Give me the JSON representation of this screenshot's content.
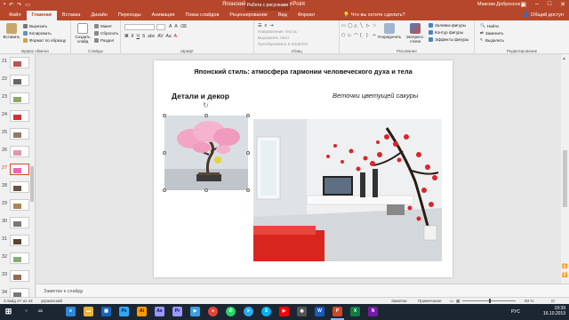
{
  "window": {
    "title": "Японский стиль.pptx - PowerPoint",
    "context_tab": "Работа с рисунками",
    "user": "Максим Доброскок"
  },
  "tabs": [
    "Файл",
    "Главная",
    "Вставка",
    "Дизайн",
    "Переходы",
    "Анимация",
    "Показ слайдов",
    "Рецензирование",
    "Вид",
    "Формат"
  ],
  "tell_me": "Что вы хотите сделать?",
  "share": "Общий доступ",
  "ribbon": {
    "paste": "Вставить",
    "cut": "Вырезать",
    "copy": "Копировать",
    "format_painter": "Формат по образцу",
    "clipboard_label": "Буфер обмена",
    "new_slide": "Создать слайд",
    "layout": "Макет",
    "reset": "Сбросить",
    "section": "Раздел",
    "slides_label": "Слайды",
    "font_label": "Шрифт",
    "text_direction": "Направление текста",
    "align_text": "Выровнять текст",
    "smartart": "Преобразовать в SmartArt",
    "paragraph_label": "Абзац",
    "arrange": "Упорядочить",
    "quick_styles": "Экспресс-стили",
    "shape_fill": "Заливка фигуры",
    "shape_outline": "Контур фигуры",
    "shape_effects": "Эффекты фигуры",
    "drawing_label": "Рисование",
    "find": "Найти",
    "replace": "Заменить",
    "select": "Выделить",
    "editing_label": "Редактирование"
  },
  "thumbnails": [
    {
      "num": "21"
    },
    {
      "num": "22"
    },
    {
      "num": "23"
    },
    {
      "num": "24"
    },
    {
      "num": "25"
    },
    {
      "num": "26"
    },
    {
      "num": "27"
    },
    {
      "num": "28"
    },
    {
      "num": "29"
    },
    {
      "num": "30"
    },
    {
      "num": "31"
    },
    {
      "num": "32"
    },
    {
      "num": "33"
    },
    {
      "num": "34"
    }
  ],
  "active_thumbnail": "27",
  "slide": {
    "title": "Японский стиль: атмосфера гармонии человеческого духа и тела",
    "subtitle": "Детали и декор",
    "caption": "Веточки цветущей сакуры"
  },
  "notes_placeholder": "Заметки к слайду",
  "status": {
    "slide_counter": "Слайд 27 из 43",
    "language": "украинский",
    "notes_btn": "Заметки",
    "comments_btn": "Примечания",
    "zoom": "83 %"
  },
  "taskbar": {
    "lang": "РУС",
    "time": "19:39",
    "date": "16.10.2019"
  },
  "colors": {
    "accent": "#b7472a",
    "taskbar": "#1c2633"
  }
}
